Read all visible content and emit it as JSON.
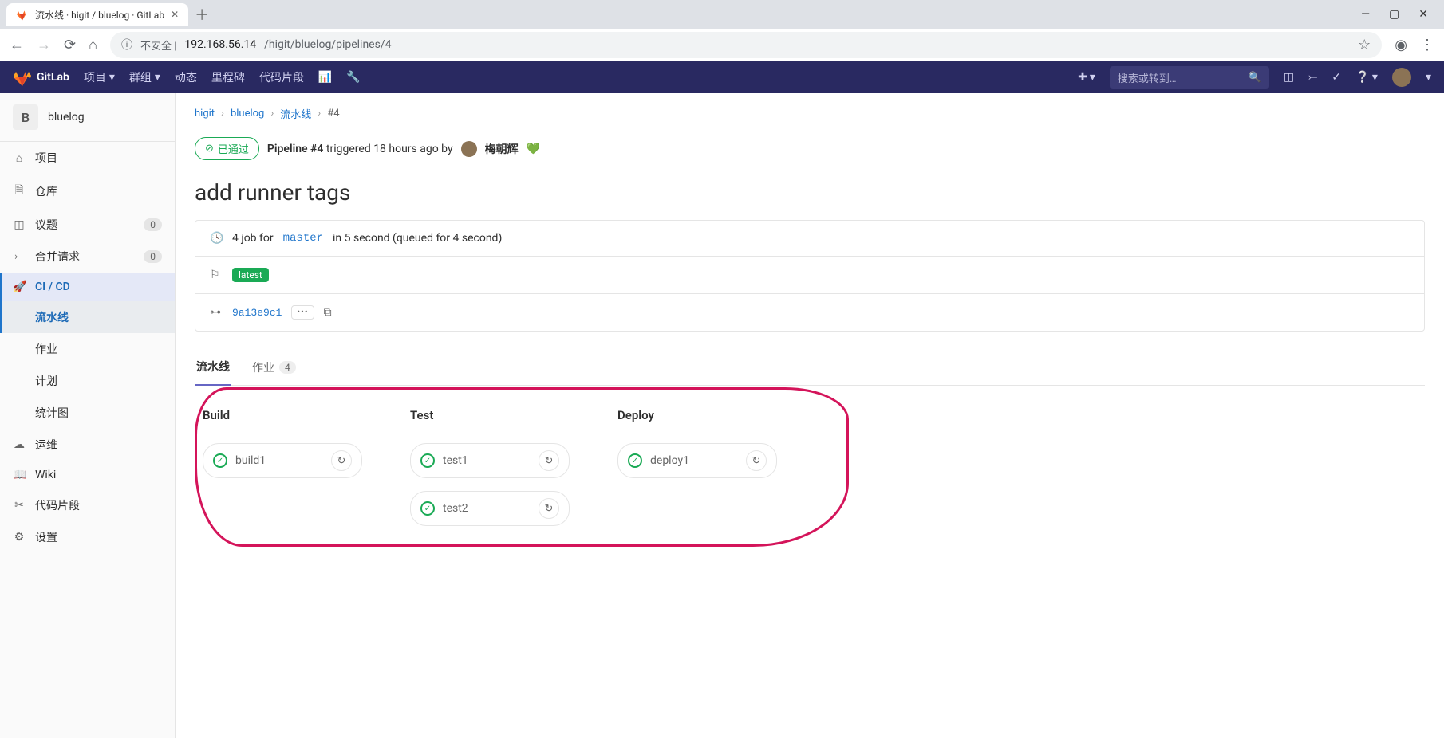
{
  "browser": {
    "tab_title": "流水线 · higit / bluelog · GitLab",
    "url_prefix": "不安全 |",
    "url_host": "192.168.56.14",
    "url_path": "/higit/bluelog/pipelines/4"
  },
  "header": {
    "brand": "GitLab",
    "nav": {
      "project": "项目",
      "groups": "群组",
      "activity": "动态",
      "milestones": "里程碑",
      "snippets": "代码片段"
    },
    "search_placeholder": "搜索或转到…"
  },
  "sidebar": {
    "project_initial": "B",
    "project_name": "bluelog",
    "items": {
      "project": "项目",
      "repo": "仓库",
      "issues": "议题",
      "issues_count": "0",
      "mrs": "合并请求",
      "mrs_count": "0",
      "cicd": "CI / CD",
      "pipelines": "流水线",
      "jobs": "作业",
      "schedules": "计划",
      "charts": "统计图",
      "ops": "运维",
      "wiki": "Wiki",
      "snippets": "代码片段",
      "settings": "设置"
    }
  },
  "breadcrumb": {
    "group": "higit",
    "project": "bluelog",
    "section": "流水线",
    "id": "#4"
  },
  "pipeline": {
    "status": "已通过",
    "label": "Pipeline #4",
    "trigger_text": "triggered 18 hours ago by",
    "author": "梅朝辉",
    "title": "add runner tags",
    "jobs_prefix": "4 job for",
    "branch": "master",
    "duration_text": "in 5 second (queued for 4 second)",
    "tag": "latest",
    "sha": "9a13e9c1"
  },
  "tabs": {
    "pipeline": "流水线",
    "jobs": "作业",
    "jobs_count": "4"
  },
  "stages": [
    {
      "name": "Build",
      "jobs": [
        "build1"
      ]
    },
    {
      "name": "Test",
      "jobs": [
        "test1",
        "test2"
      ]
    },
    {
      "name": "Deploy",
      "jobs": [
        "deploy1"
      ]
    }
  ]
}
